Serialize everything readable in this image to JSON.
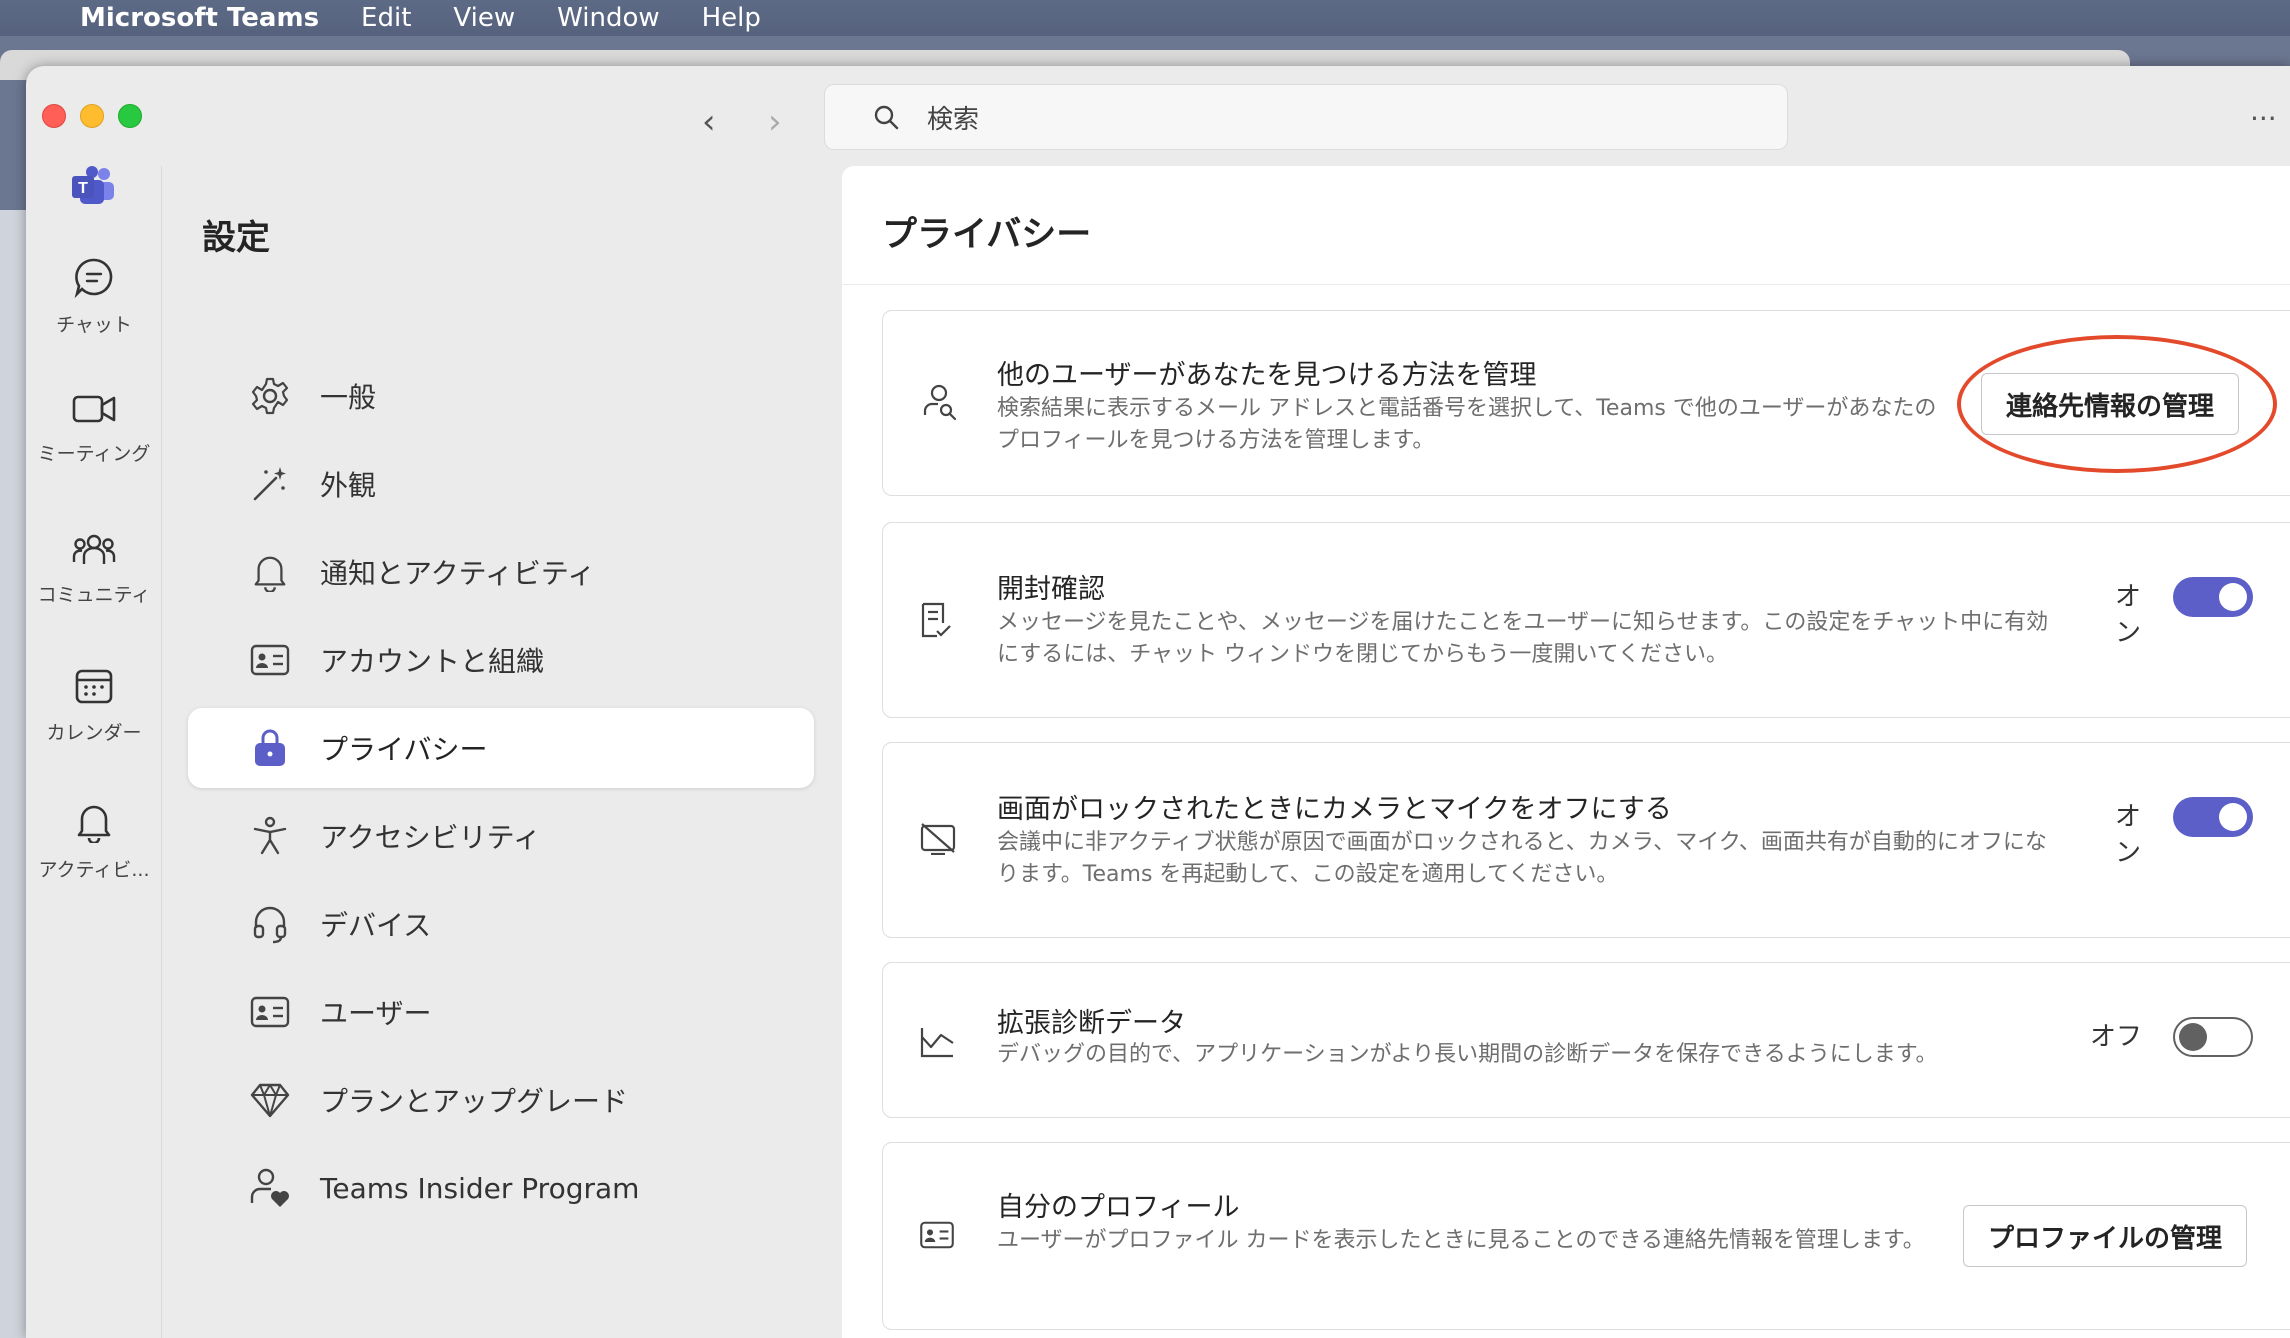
{
  "menubar": {
    "app": "Microsoft Teams",
    "items": [
      "Edit",
      "View",
      "Window",
      "Help"
    ]
  },
  "search": {
    "placeholder": "検索"
  },
  "rail": {
    "items": [
      {
        "label": "チャット",
        "icon": "chat-icon"
      },
      {
        "label": "ミーティング",
        "icon": "video-icon"
      },
      {
        "label": "コミュニティ",
        "icon": "community-icon"
      },
      {
        "label": "カレンダー",
        "icon": "calendar-icon"
      },
      {
        "label": "アクティビ...",
        "icon": "bell-icon"
      }
    ]
  },
  "settings": {
    "title": "設定",
    "nav": [
      {
        "label": "一般",
        "icon": "gear-icon"
      },
      {
        "label": "外観",
        "icon": "magic-wand-icon"
      },
      {
        "label": "通知とアクティビティ",
        "icon": "bell-icon"
      },
      {
        "label": "アカウントと組織",
        "icon": "contact-card-icon"
      },
      {
        "label": "プライバシー",
        "icon": "lock-icon",
        "active": true
      },
      {
        "label": "アクセシビリティ",
        "icon": "accessibility-icon"
      },
      {
        "label": "デバイス",
        "icon": "headset-icon"
      },
      {
        "label": "ユーザー",
        "icon": "contact-card-icon"
      },
      {
        "label": "プランとアップグレード",
        "icon": "diamond-icon"
      },
      {
        "label": "Teams Insider Program",
        "icon": "person-heart-icon"
      }
    ]
  },
  "privacy": {
    "title": "プライバシー",
    "discover": {
      "title": "他のユーザーがあなたを見つける方法を管理",
      "desc": "検索結果に表示するメール アドレスと電話番号を選択して、Teams で他のユーザーがあなたのプロフィールを見つける方法を管理します。",
      "button": "連絡先情報の管理"
    },
    "read_receipts": {
      "title": "開封確認",
      "desc": "メッセージを見たことや、メッセージを届けたことをユーザーに知らせます。この設定をチャット中に有効にするには、チャット ウィンドウを閉じてからもう一度開いてください。",
      "state_label": "オン",
      "on": true
    },
    "lock_screen": {
      "title": "画面がロックされたときにカメラとマイクをオフにする",
      "desc": "会議中に非アクティブ状態が原因で画面がロックされると、カメラ、マイク、画面共有が自動的にオフになります。Teams を再起動して、この設定を適用してください。",
      "state_label": "オン",
      "on": true
    },
    "diagnostics": {
      "title": "拡張診断データ",
      "desc": "デバッグの目的で、アプリケーションがより長い期間の診断データを保存できるようにします。",
      "state_label": "オフ",
      "on": false
    },
    "profile": {
      "title": "自分のプロフィール",
      "desc": "ユーザーがプロファイル カードを表示したときに見ることのできる連絡先情報を管理します。",
      "button": "プロファイルの管理"
    }
  },
  "colors": {
    "accent": "#5b5fc7",
    "highlight": "#e34a2c"
  }
}
